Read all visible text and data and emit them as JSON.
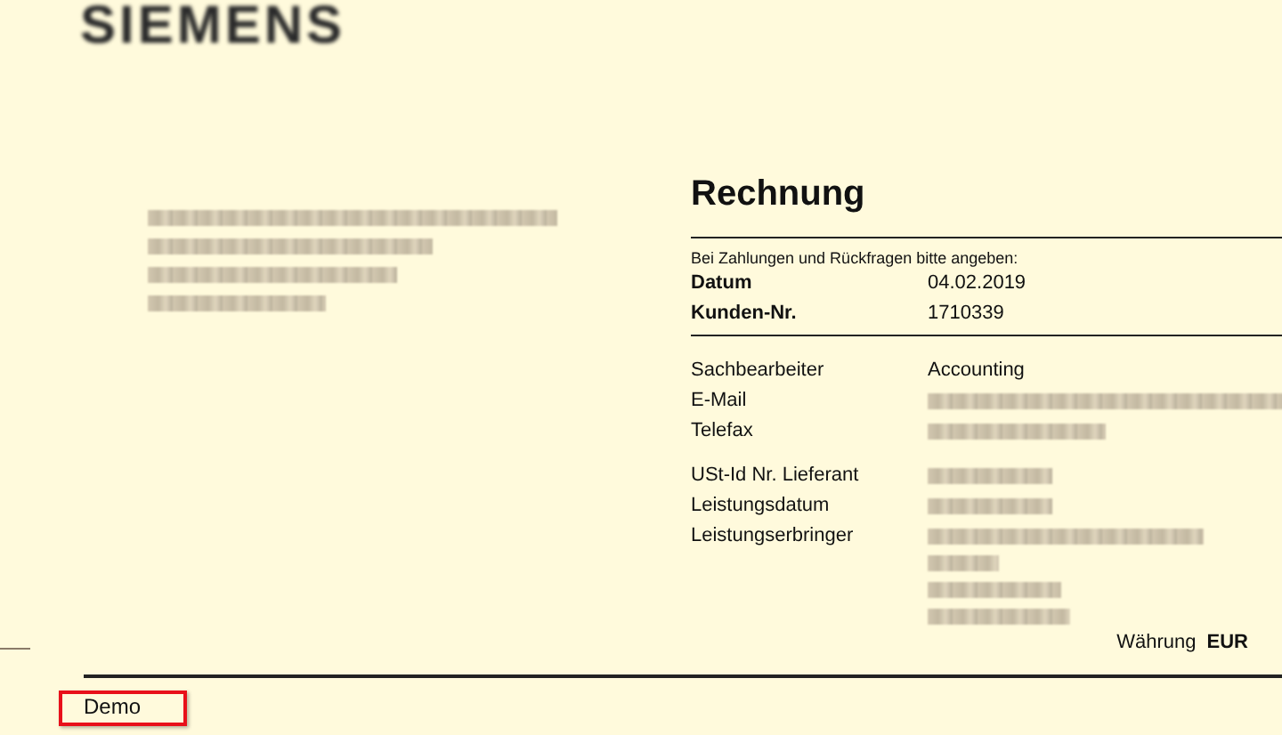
{
  "logo": "SIEMENS",
  "recipient": [
    {
      "kind": "redacted"
    },
    {
      "kind": "redacted"
    },
    {
      "kind": "redacted"
    },
    {
      "kind": "redacted"
    }
  ],
  "title": "Rechnung",
  "reference_note": "Bei Zahlungen und Rückfragen bitte angeben:",
  "reference_fields": [
    {
      "label": "Datum",
      "value": "04.02.2019"
    },
    {
      "label": "Kunden-Nr.",
      "value": "1710339"
    }
  ],
  "contact_fields": [
    {
      "label": "Sachbearbeiter",
      "value": "Accounting"
    },
    {
      "label": "E-Mail",
      "redacted_lines": [
        {
          "kind": "redacted"
        }
      ]
    },
    {
      "label": "Telefax",
      "redacted_lines": [
        {
          "kind": "redacted"
        }
      ]
    }
  ],
  "supplier_fields": [
    {
      "label": "USt-Id Nr. Lieferant",
      "redacted_lines": [
        {
          "kind": "redacted"
        }
      ]
    },
    {
      "label": "Leistungsdatum",
      "redacted_lines": [
        {
          "kind": "redacted"
        }
      ]
    },
    {
      "label": "Leistungserbringer",
      "redacted_lines": [
        {
          "kind": "redacted"
        },
        {
          "kind": "redacted"
        },
        {
          "kind": "redacted"
        },
        {
          "kind": "redacted"
        }
      ]
    }
  ],
  "currency": {
    "label": "Währung",
    "value": "EUR"
  },
  "annotation": {
    "text": "Demo"
  }
}
